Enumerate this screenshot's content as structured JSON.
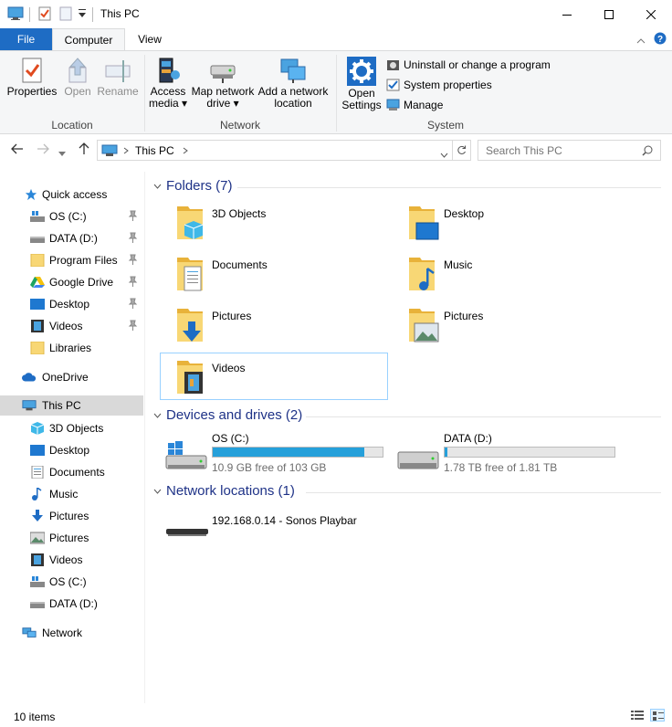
{
  "window": {
    "title": "This PC"
  },
  "ribbon_tabs": {
    "file": "File",
    "computer": "Computer",
    "view": "View"
  },
  "ribbon": {
    "location": {
      "label": "Location",
      "properties": "Properties",
      "open": "Open",
      "rename": "Rename"
    },
    "network": {
      "label": "Network",
      "access_media_1": "Access",
      "access_media_2": "media ▾",
      "map_drive_1": "Map network",
      "map_drive_2": "drive ▾",
      "add_location_1": "Add a network",
      "add_location_2": "location"
    },
    "system": {
      "label": "System",
      "open_settings_1": "Open",
      "open_settings_2": "Settings",
      "uninstall": "Uninstall or change a program",
      "system_properties": "System properties",
      "manage": "Manage"
    }
  },
  "address": {
    "path": "This PC",
    "search_placeholder": "Search This PC"
  },
  "nav": {
    "quick_access": "Quick access",
    "quick_items": [
      {
        "label": "OS (C:)",
        "icon": "drive-windows-icon"
      },
      {
        "label": "DATA (D:)",
        "icon": "drive-icon"
      },
      {
        "label": "Program Files",
        "icon": "folder-icon"
      },
      {
        "label": "Google Drive",
        "icon": "google-drive-icon"
      },
      {
        "label": "Desktop",
        "icon": "desktop-icon"
      },
      {
        "label": "Videos",
        "icon": "videos-icon"
      },
      {
        "label": "Libraries",
        "icon": "folder-icon"
      }
    ],
    "onedrive": "OneDrive",
    "this_pc": "This PC",
    "pc_items": [
      {
        "label": "3D Objects"
      },
      {
        "label": "Desktop"
      },
      {
        "label": "Documents"
      },
      {
        "label": "Music"
      },
      {
        "label": "Pictures"
      },
      {
        "label": "Pictures"
      },
      {
        "label": "Videos"
      },
      {
        "label": "OS (C:)"
      },
      {
        "label": "DATA (D:)"
      }
    ],
    "network": "Network"
  },
  "main": {
    "folders_header": "Folders (7)",
    "folders": [
      {
        "label": "3D Objects",
        "icon": "3d-objects-folder-icon"
      },
      {
        "label": "Desktop",
        "icon": "desktop-folder-icon"
      },
      {
        "label": "Documents",
        "icon": "documents-folder-icon"
      },
      {
        "label": "Music",
        "icon": "music-folder-icon"
      },
      {
        "label": "Pictures",
        "icon": "pictures-download-folder-icon"
      },
      {
        "label": "Pictures",
        "icon": "pictures-folder-icon"
      },
      {
        "label": "Videos",
        "icon": "videos-folder-icon"
      }
    ],
    "devices_header": "Devices and drives (2)",
    "drives": [
      {
        "name": "OS (C:)",
        "free": "10.9 GB free of 103 GB",
        "used_fraction": 0.894,
        "icon": "windows-drive-icon"
      },
      {
        "name": "DATA (D:)",
        "free": "1.78 TB free of 1.81 TB",
        "used_fraction": 0.017,
        "icon": "hard-drive-icon"
      }
    ],
    "network_header": "Network locations (1)",
    "network_items": [
      {
        "label": "192.168.0.14 - Sonos Playbar",
        "icon": "media-device-icon"
      }
    ]
  },
  "status": {
    "items": "10 items"
  },
  "colors": {
    "accent": "#1e6cc4",
    "header_text": "#1e3287",
    "drive_fill": "#26a0da",
    "folder": "#f8d775"
  }
}
